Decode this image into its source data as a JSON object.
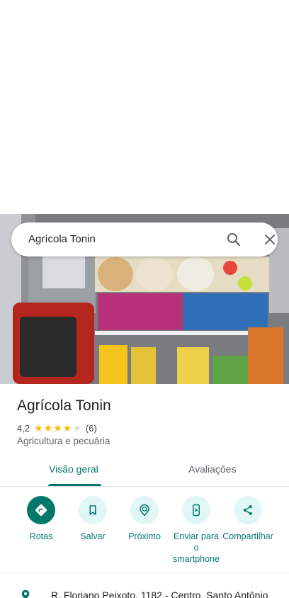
{
  "search": {
    "query": "Agrícola Tonin"
  },
  "place": {
    "name": "Agrícola Tonin",
    "rating": "4,2",
    "stars_filled": 4,
    "stars_total": 5,
    "review_count": "(6)",
    "category": "Agricultura e pecuária"
  },
  "tabs": [
    {
      "label": "Visão geral",
      "active": true
    },
    {
      "label": "Avaliações",
      "active": false
    }
  ],
  "actions": [
    {
      "label": "Rotas",
      "icon": "directions-icon"
    },
    {
      "label": "Salvar",
      "icon": "bookmark-icon"
    },
    {
      "label": "Próximo",
      "icon": "nearby-icon"
    },
    {
      "label": "Enviar para o smartphone",
      "icon": "send-to-phone-icon"
    },
    {
      "label": "Compartilhar",
      "icon": "share-icon"
    }
  ],
  "address": {
    "text": "R. Floriano Peixoto, 1182 - Centro, Santo Antônio"
  },
  "colors": {
    "accent": "#00796b",
    "accent_light": "#e0f7f5",
    "star": "#fbbc04"
  }
}
